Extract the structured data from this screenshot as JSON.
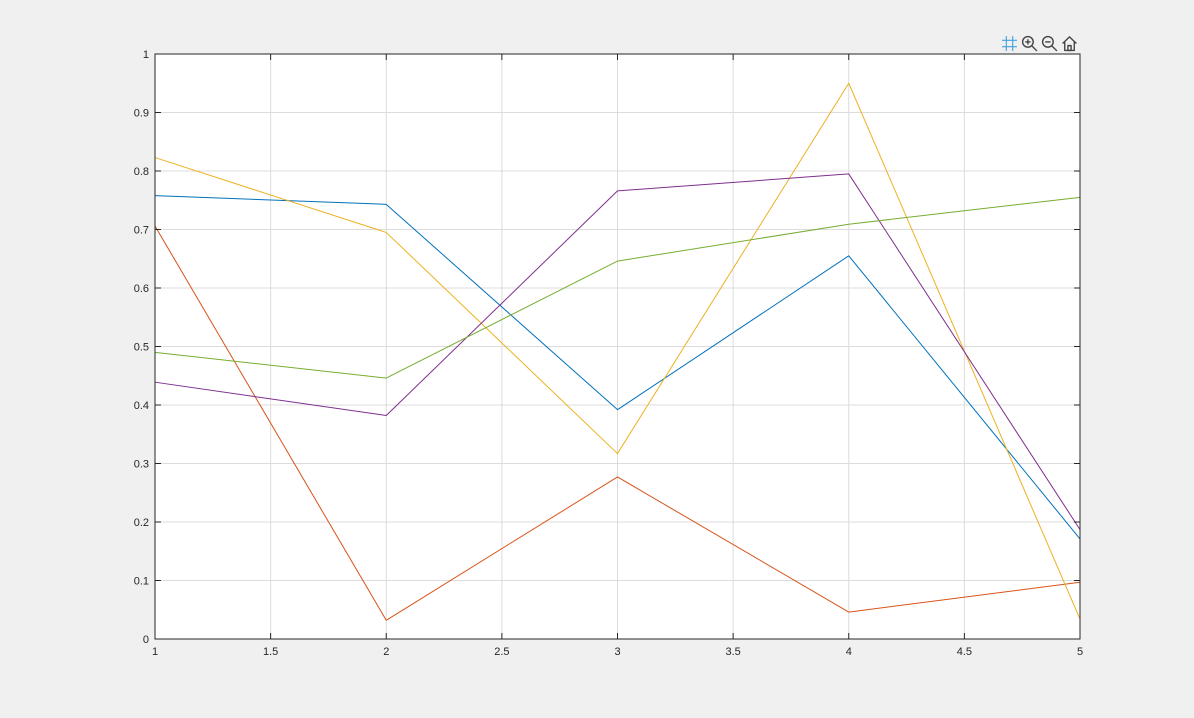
{
  "toolbar": {
    "icons": [
      "data-cursor-icon",
      "zoom-in-icon",
      "zoom-out-icon",
      "home-icon"
    ]
  },
  "colors": {
    "background": "#f0f0f0",
    "axes_background": "#ffffff",
    "grid": "#dcdcdc",
    "axis": "#262626",
    "series": [
      "#0072BD",
      "#D95319",
      "#EDB120",
      "#7E2F8E",
      "#77AC30"
    ]
  },
  "chart_data": {
    "type": "line",
    "title": "",
    "xlabel": "",
    "ylabel": "",
    "xlim": [
      1,
      5
    ],
    "ylim": [
      0,
      1
    ],
    "grid": true,
    "x": [
      1,
      2,
      3,
      4,
      5
    ],
    "x_ticks": [
      "1",
      "1.5",
      "2",
      "2.5",
      "3",
      "3.5",
      "4",
      "4.5",
      "5"
    ],
    "x_tick_values": [
      1,
      1.5,
      2,
      2.5,
      3,
      3.5,
      4,
      4.5,
      5
    ],
    "y_ticks": [
      "0",
      "0.1",
      "0.2",
      "0.3",
      "0.4",
      "0.5",
      "0.6",
      "0.7",
      "0.8",
      "0.9",
      "1"
    ],
    "y_tick_values": [
      0,
      0.1,
      0.2,
      0.3,
      0.4,
      0.5,
      0.6,
      0.7,
      0.8,
      0.9,
      1
    ],
    "series": [
      {
        "color": "#0072BD",
        "values": [
          0.758,
          0.743,
          0.392,
          0.655,
          0.171
        ]
      },
      {
        "color": "#D95319",
        "values": [
          0.706,
          0.032,
          0.277,
          0.046,
          0.097
        ]
      },
      {
        "color": "#EDB120",
        "values": [
          0.823,
          0.695,
          0.317,
          0.95,
          0.034
        ]
      },
      {
        "color": "#7E2F8E",
        "values": [
          0.439,
          0.382,
          0.766,
          0.795,
          0.187
        ]
      },
      {
        "color": "#77AC30",
        "values": [
          0.49,
          0.446,
          0.646,
          0.709,
          0.755
        ]
      }
    ]
  }
}
